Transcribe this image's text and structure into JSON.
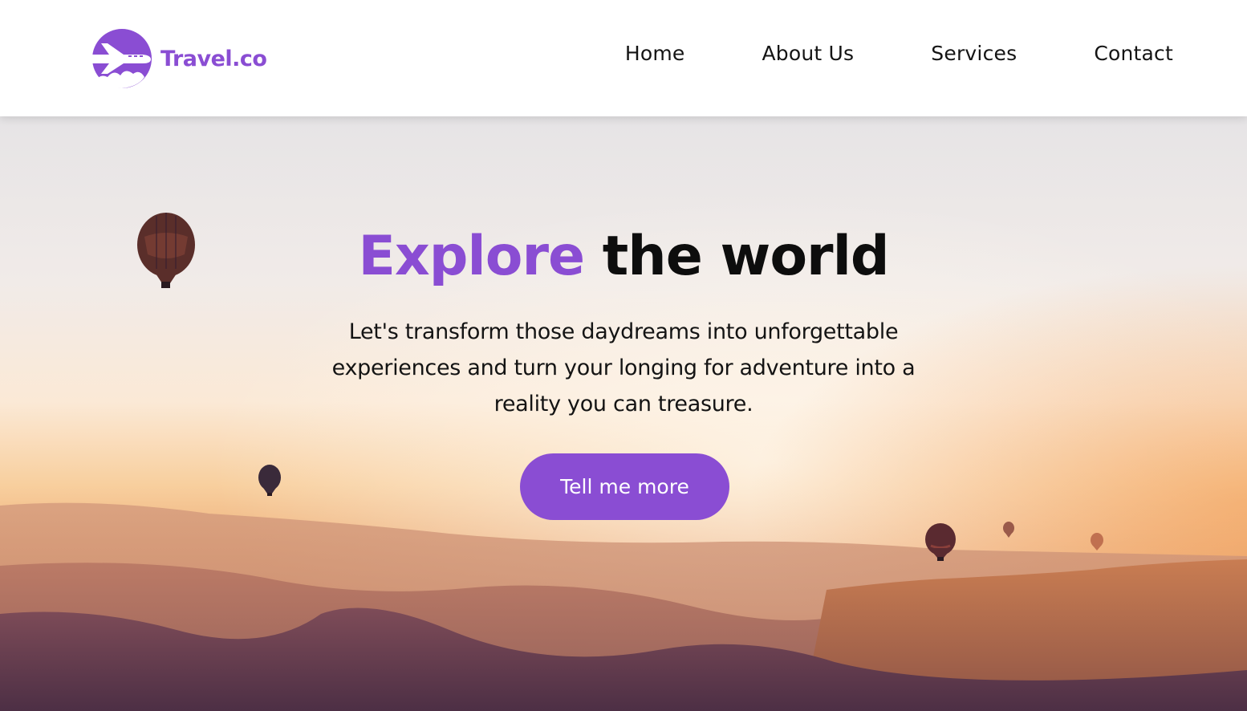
{
  "brand": {
    "name": "Travel.co",
    "accent_color": "#8a4dd3",
    "logo_icon": "airplane-logo-icon"
  },
  "nav": {
    "items": [
      {
        "label": "Home"
      },
      {
        "label": "About Us"
      },
      {
        "label": "Services"
      },
      {
        "label": "Contact"
      }
    ]
  },
  "hero": {
    "headline_accent": "Explore",
    "headline_rest": "the world",
    "tagline": "Let's transform those daydreams into unforgettable experiences and turn your longing for adventure into a reality you can treasure.",
    "cta_label": "Tell me more",
    "background": "hot-air-balloons-over-valley-at-sunrise"
  }
}
